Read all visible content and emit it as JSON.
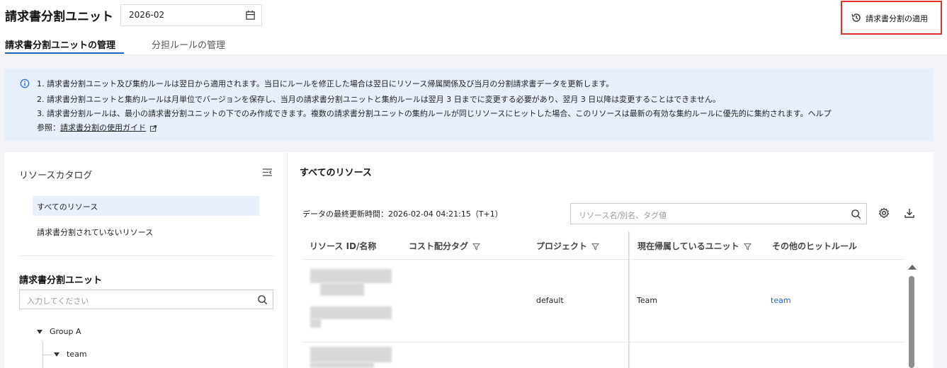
{
  "header": {
    "title": "請求書分割ユニット",
    "date": "2026-02",
    "apply_button": "請求書分割の適用",
    "tabs": [
      {
        "label": "請求書分割ユニットの管理"
      },
      {
        "label": "分担ルールの管理"
      }
    ]
  },
  "notice": {
    "line1": "1. 請求書分割ユニット及び集約ルールは翌日から適用されます。当日にルールを修正した場合は翌日にリソース帰属関係及び当月の分割請求書データを更新します。",
    "line2": "2. 請求書分割ユニットと集約ルールは月単位でバージョンを保存し、当月の請求書分割ユニットと集約ルールは翌月 3 日までに変更する必要があり、翌月 3 日以降は変更することはできません。",
    "line3": "3. 請求書分割ルールは、最小の請求書分割ユニットの下でのみ作成できます。複数の請求書分割ユニットの集約ルールが同じリソースにヒットした場合、このリソースは最新の有効な集約ルールに優先的に集約されます。ヘルプ",
    "line4_prefix": "参照：",
    "line4_link": "請求書分割の使用ガイド"
  },
  "catalog": {
    "title": "リソースカタログ",
    "items": [
      {
        "label": "すべてのリソース"
      },
      {
        "label": "請求書分割されていないリソース"
      }
    ]
  },
  "units": {
    "title": "請求書分割ユニット",
    "search_placeholder": "入力してください",
    "tree": [
      {
        "label": "Group A"
      },
      {
        "label": "team"
      }
    ]
  },
  "resources": {
    "title": "すべてのリソース",
    "updated_label": "データの最終更新時間：2026-02-04 04:21:15（T+1）",
    "search_placeholder": "リソース名/別名、タグ値",
    "columns": [
      "リソース ID/名称",
      "コスト配分タグ",
      "プロジェクト",
      "現在帰属しているユニット",
      "その他のヒットルール"
    ],
    "rows": [
      {
        "project": "default",
        "unit": "Team",
        "other_rule": "team"
      }
    ]
  },
  "colors": {
    "accent": "#1f5fd0",
    "highlight_border": "#e0302b",
    "notice_bg": "#e7eefc"
  }
}
